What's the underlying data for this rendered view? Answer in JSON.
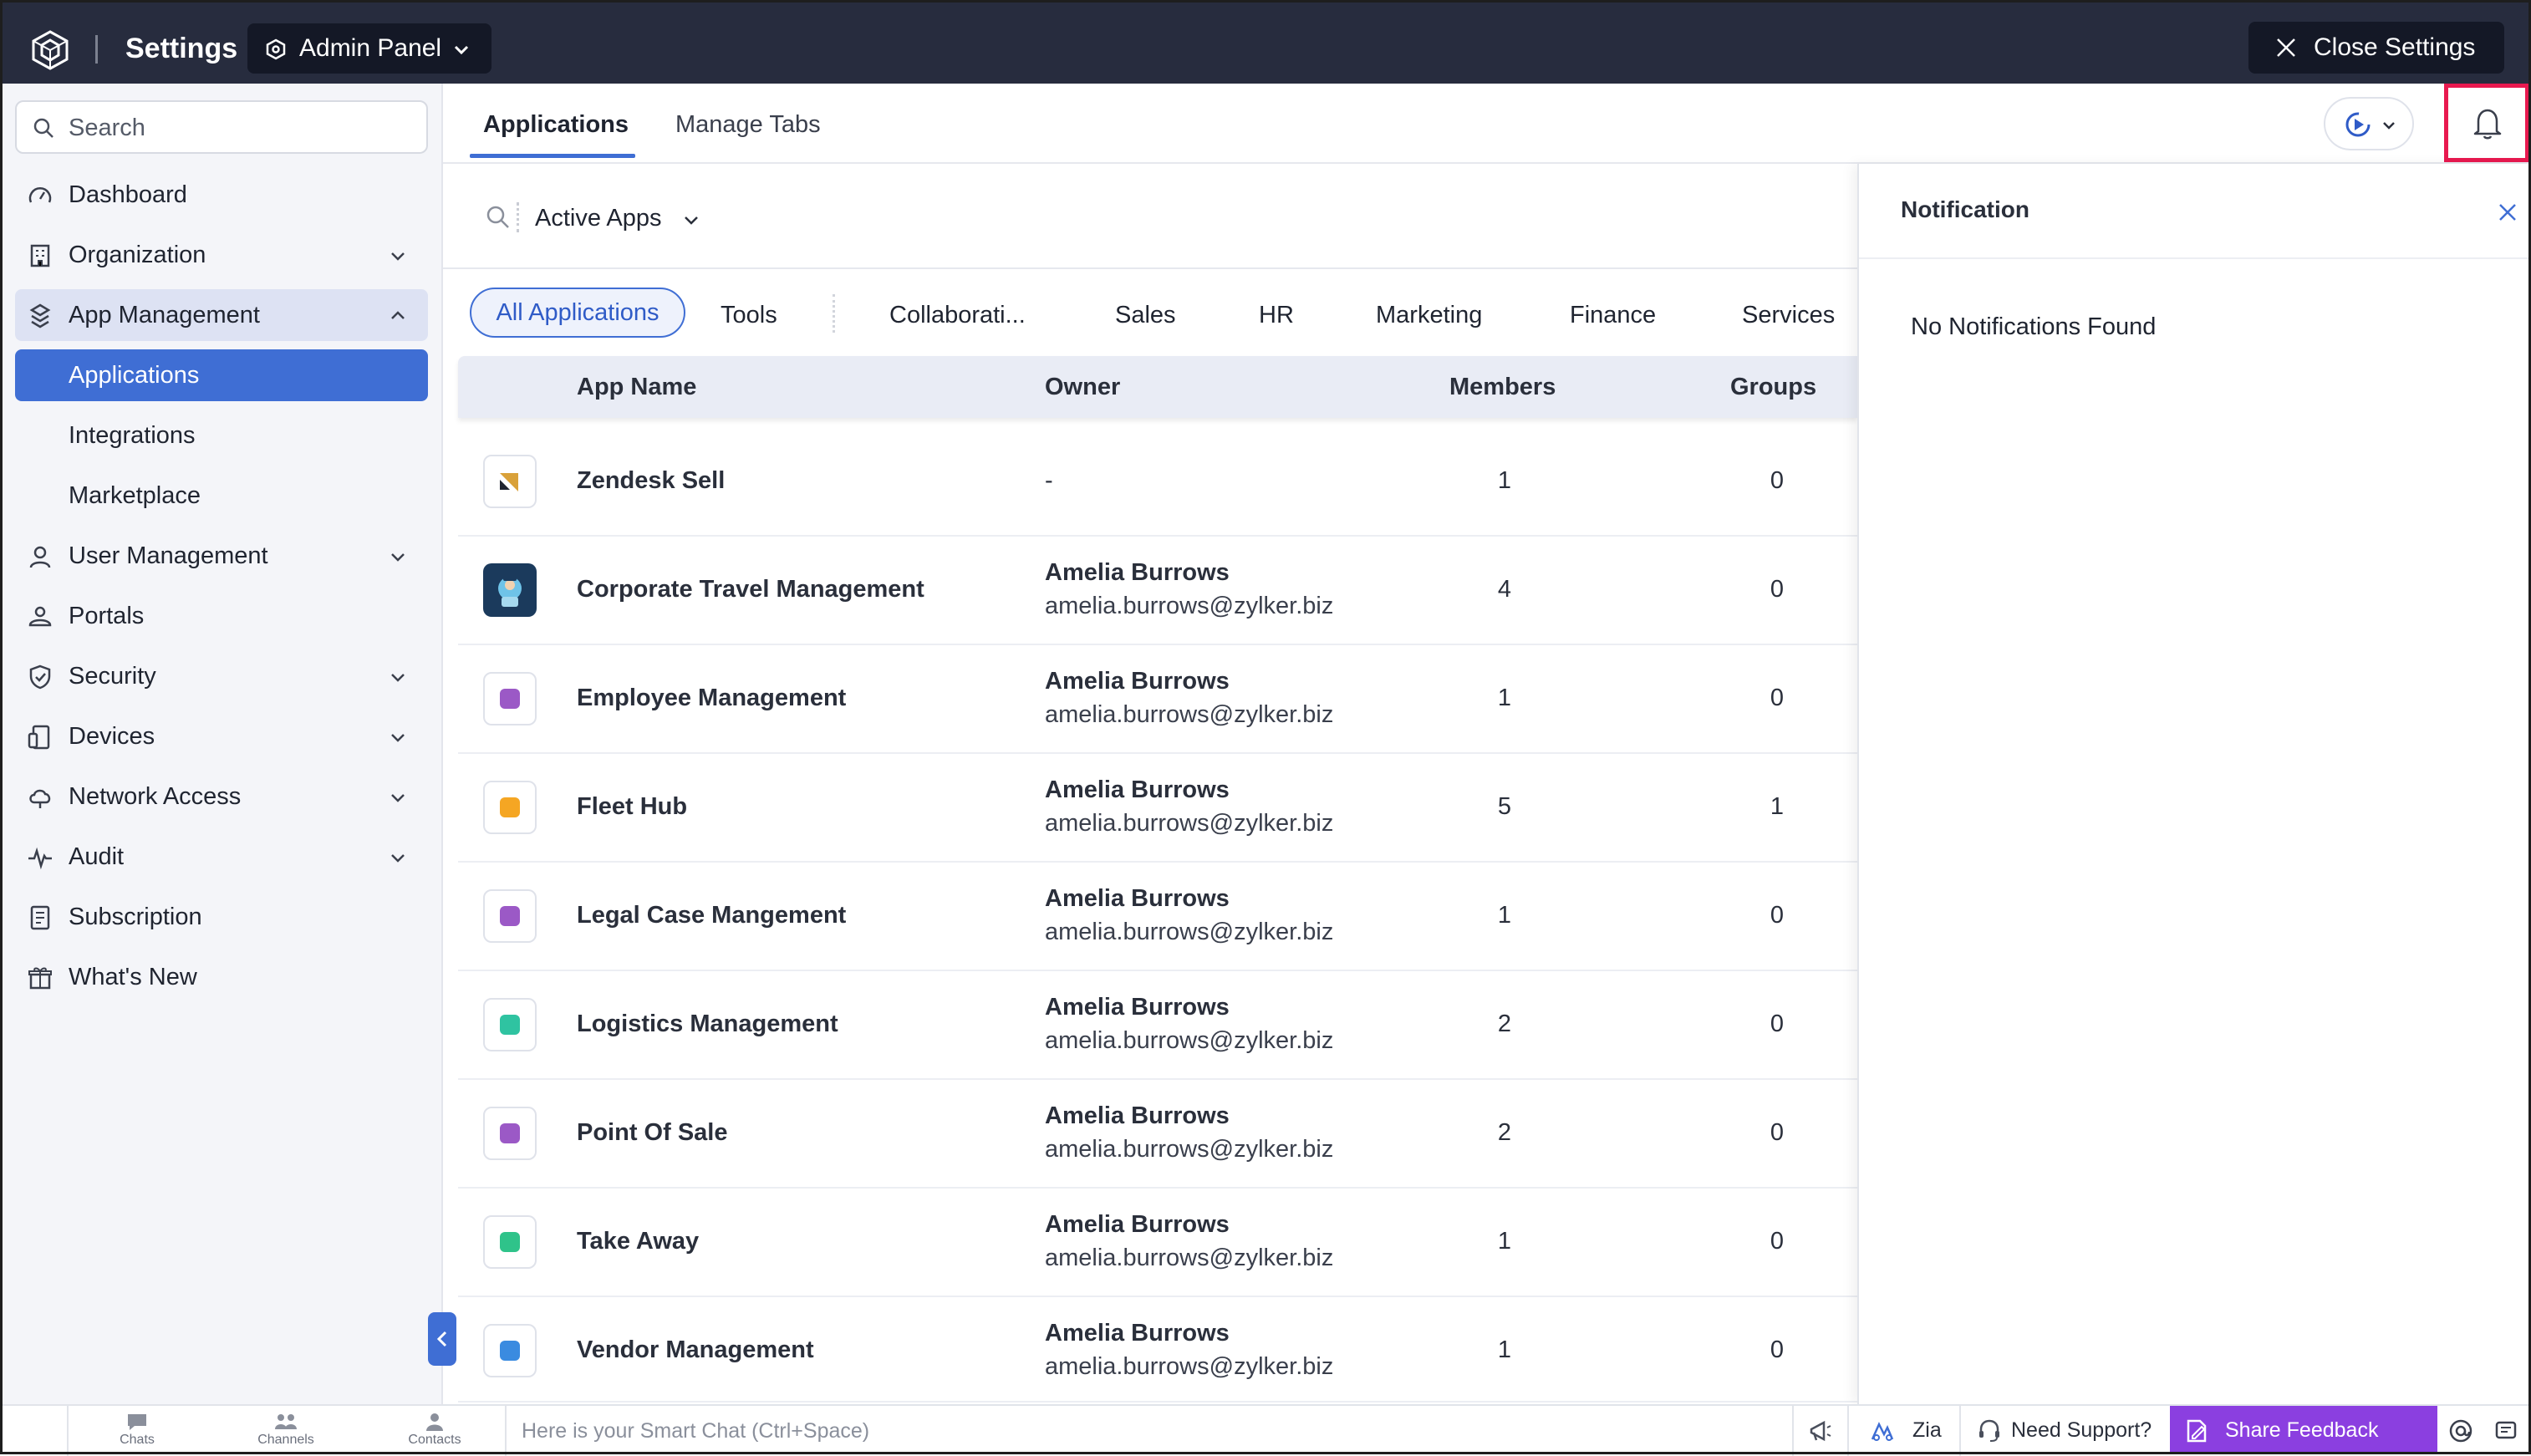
{
  "header": {
    "title": "Settings",
    "panel_selector": "Admin Panel",
    "close_label": "Close Settings"
  },
  "sidebar": {
    "search_placeholder": "Search",
    "items": [
      {
        "label": "Dashboard",
        "icon": "gauge-icon"
      },
      {
        "label": "Organization",
        "icon": "building-icon",
        "expandable": true
      },
      {
        "label": "App Management",
        "icon": "apps-icon",
        "expandable": true,
        "expanded": true
      },
      {
        "label": "Applications",
        "sub": true,
        "active": true
      },
      {
        "label": "Integrations",
        "sub": true
      },
      {
        "label": "Marketplace",
        "sub": true
      },
      {
        "label": "User Management",
        "icon": "user-icon",
        "expandable": true
      },
      {
        "label": "Portals",
        "icon": "portal-icon"
      },
      {
        "label": "Security",
        "icon": "shield-icon",
        "expandable": true
      },
      {
        "label": "Devices",
        "icon": "devices-icon",
        "expandable": true
      },
      {
        "label": "Network Access",
        "icon": "cloud-icon",
        "expandable": true
      },
      {
        "label": "Audit",
        "icon": "pulse-icon",
        "expandable": true
      },
      {
        "label": "Subscription",
        "icon": "document-icon"
      },
      {
        "label": "What's New",
        "icon": "gift-icon"
      }
    ]
  },
  "main": {
    "tabs": [
      "Applications",
      "Manage Tabs"
    ],
    "filter_label": "Active Apps",
    "categories": [
      "All Applications",
      "Tools",
      "Collaborati...",
      "Sales",
      "HR",
      "Marketing",
      "Finance",
      "Services"
    ],
    "columns": [
      "App Name",
      "Owner",
      "Members",
      "Groups"
    ],
    "rows": [
      {
        "name": "Zendesk Sell",
        "owner_name": "-",
        "owner_email": "",
        "members": "1",
        "groups": "0",
        "icon_color": "#d9a13a"
      },
      {
        "name": "Corporate Travel Management",
        "owner_name": "Amelia Burrows",
        "owner_email": "amelia.burrows@zylker.biz",
        "members": "4",
        "groups": "0",
        "icon_color": "#1b3a5c"
      },
      {
        "name": "Employee Management",
        "owner_name": "Amelia Burrows",
        "owner_email": "amelia.burrows@zylker.biz",
        "members": "1",
        "groups": "0",
        "icon_color": "#9b59c6"
      },
      {
        "name": "Fleet Hub",
        "owner_name": "Amelia Burrows",
        "owner_email": "amelia.burrows@zylker.biz",
        "members": "5",
        "groups": "1",
        "icon_color": "#f5a623"
      },
      {
        "name": "Legal Case Mangement",
        "owner_name": "Amelia Burrows",
        "owner_email": "amelia.burrows@zylker.biz",
        "members": "1",
        "groups": "0",
        "icon_color": "#9b59c6"
      },
      {
        "name": "Logistics Management",
        "owner_name": "Amelia Burrows",
        "owner_email": "amelia.burrows@zylker.biz",
        "members": "2",
        "groups": "0",
        "icon_color": "#2fc3a1"
      },
      {
        "name": "Point Of Sale",
        "owner_name": "Amelia Burrows",
        "owner_email": "amelia.burrows@zylker.biz",
        "members": "2",
        "groups": "0",
        "icon_color": "#9b59c6"
      },
      {
        "name": "Take Away",
        "owner_name": "Amelia Burrows",
        "owner_email": "amelia.burrows@zylker.biz",
        "members": "1",
        "groups": "0",
        "icon_color": "#2fc38a"
      },
      {
        "name": "Vendor Management",
        "owner_name": "Amelia Burrows",
        "owner_email": "amelia.burrows@zylker.biz",
        "members": "1",
        "groups": "0",
        "icon_color": "#3a8be0"
      }
    ]
  },
  "notification": {
    "title": "Notification",
    "empty_text": "No Notifications Found"
  },
  "bottombar": {
    "chats": "Chats",
    "channels": "Channels",
    "contacts": "Contacts",
    "smart_chat_placeholder": "Here is your Smart Chat (Ctrl+Space)",
    "zia": "Zia",
    "support": "Need Support?",
    "feedback": "Share Feedback"
  },
  "colors": {
    "accent": "#3f6ed4",
    "topbar": "#272c3e",
    "highlight": "#e8194f",
    "feedback": "#8b3fe0"
  }
}
